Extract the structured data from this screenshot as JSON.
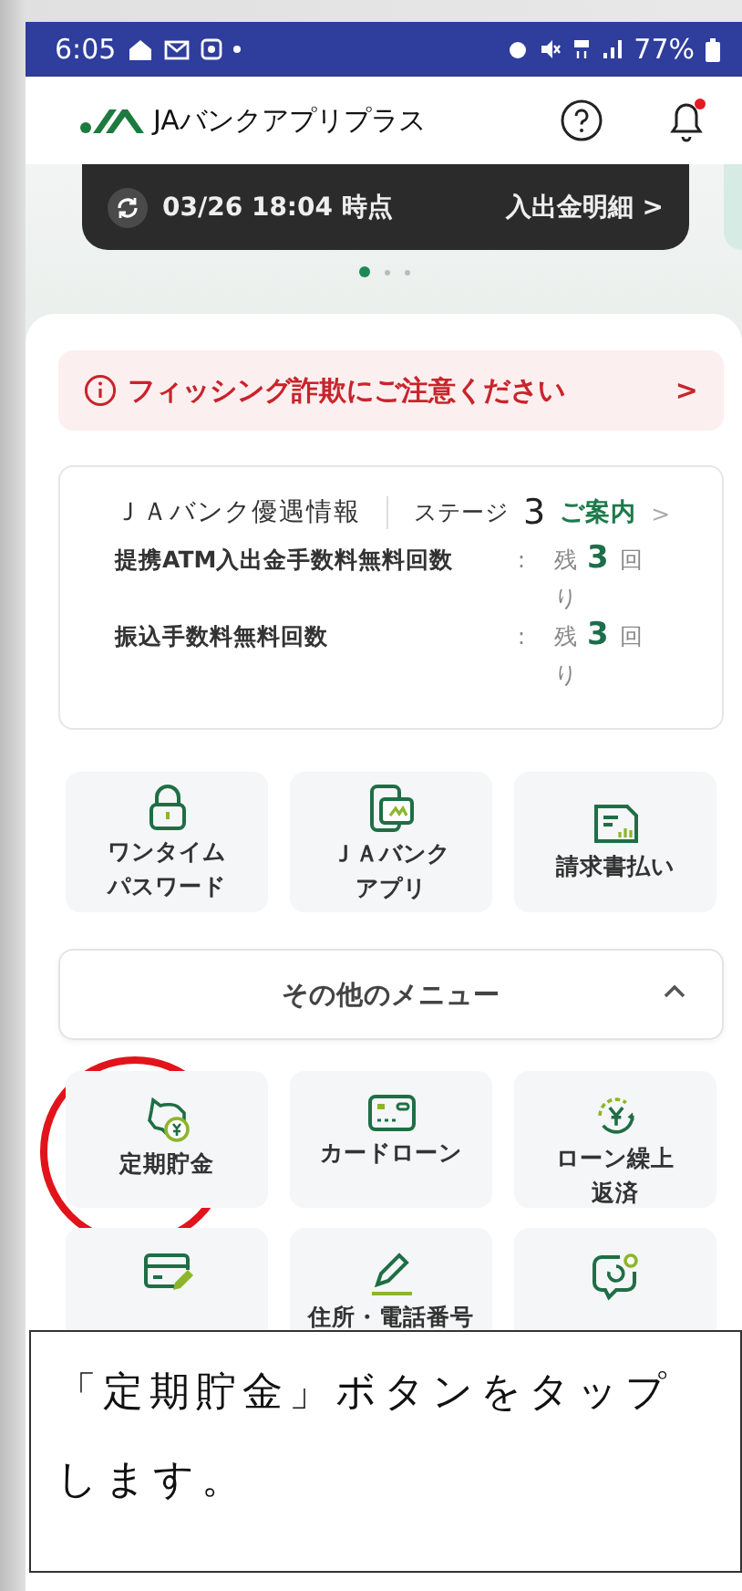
{
  "status_bar": {
    "time": "6:05",
    "battery": "77%"
  },
  "header": {
    "title": "JAバンクアプリプラス"
  },
  "balance_card": {
    "timestamp": "03/26 18:04 時点",
    "link": "入出金明細",
    "link_chevron": ">"
  },
  "carousel": [
    {
      "selected": true
    },
    {
      "selected": false
    },
    {
      "selected": false
    }
  ],
  "alert": {
    "text": "フィッシング詐欺にご注意ください",
    "chevron": ">"
  },
  "benefits": {
    "title": "ＪＡバンク優遇情報",
    "stage_label": "ステージ",
    "stage_value": "3",
    "guide_link": "ご案内",
    "guide_chevron": ">",
    "rows": [
      {
        "label": "提携ATM入出金手数料無料回数",
        "colon": ":",
        "prefix": "残",
        "count": "3",
        "unit": "回",
        "suffix": "り"
      },
      {
        "label": "振込手数料無料回数",
        "colon": ":",
        "prefix": "残",
        "count": "3",
        "unit": "回",
        "suffix": "り"
      }
    ]
  },
  "quick_tiles": [
    {
      "kind": "lock",
      "label_lines": [
        "ワンタイム",
        "パスワード"
      ]
    },
    {
      "kind": "phone",
      "label_lines": [
        "ＪＡバンク",
        "アプリ"
      ]
    },
    {
      "kind": "invoice",
      "label_lines": [
        "請求書払い"
      ]
    }
  ],
  "other_menu": {
    "title": "その他のメニュー",
    "expanded": true
  },
  "menu_items": [
    {
      "kind": "piggy",
      "label": "定期貯金",
      "highlighted": true
    },
    {
      "kind": "card",
      "label": "カードローン",
      "highlighted": false
    },
    {
      "kind": "loan",
      "label_lines": [
        "ローン繰上",
        "返済"
      ],
      "highlighted": false
    },
    {
      "kind": "account",
      "highlighted": false
    },
    {
      "kind": "pen",
      "label": "住所・電話番号",
      "highlighted": false
    },
    {
      "kind": "chat",
      "highlighted": false
    }
  ],
  "callout": {
    "text": "「定期貯金」ボタンをタップします。"
  }
}
